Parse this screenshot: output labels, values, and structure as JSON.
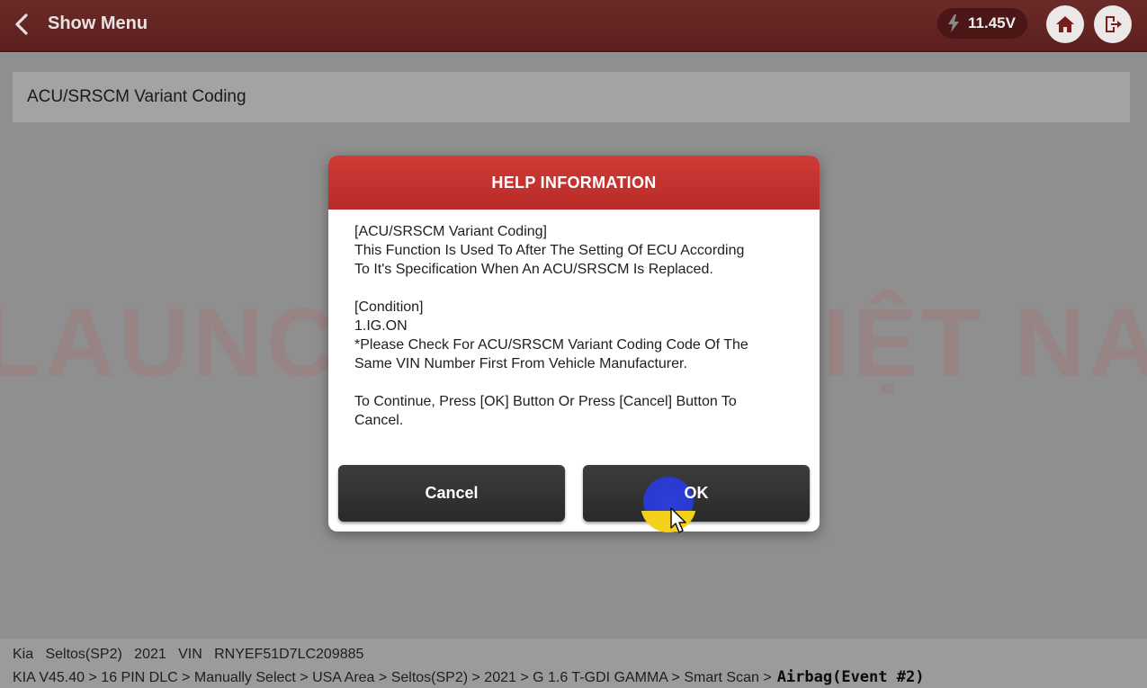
{
  "header": {
    "back_icon": "chevron-left-icon",
    "title": "Show Menu",
    "voltage": "11.45V",
    "voltage_icon": "lightning-bolt-icon",
    "home_icon": "home-icon",
    "exit_icon": "exit-icon"
  },
  "main": {
    "menu_items": [
      {
        "label": "ACU/SRSCM Variant Coding"
      }
    ],
    "watermark": "LAUNCH TECH VIỆT NAM"
  },
  "dialog": {
    "title": "HELP INFORMATION",
    "body": {
      "p1": [
        "[ACU/SRSCM Variant Coding]",
        "This Function Is Used To After The Setting Of ECU According",
        "To It's Specification When An ACU/SRSCM Is Replaced."
      ],
      "p2": [
        "[Condition]",
        "1.IG.ON",
        "*Please Check For ACU/SRSCM Variant Coding Code Of The",
        "Same VIN Number First From Vehicle Manufacturer."
      ],
      "p3": [
        "To Continue, Press [OK] Button Or Press [Cancel] Button To",
        "Cancel."
      ]
    },
    "cancel_label": "Cancel",
    "ok_label": "OK"
  },
  "footer": {
    "vehicle_info": "Kia   Seltos(SP2)   2021   VIN   RNYEF51D7LC209885",
    "path": "KIA V45.40 > 16 PIN DLC > Manually Select > USA Area > Seltos(SP2) > 2021 > G 1.6 T-GDI GAMMA > Smart Scan >",
    "current": "Airbag(Event #2)"
  },
  "colors": {
    "header_bg": "#5b1f1d",
    "dialog_header": "#c3322f",
    "button_bg": "#2f2f2f",
    "overlay_bg": "#8f8f8f",
    "click_indicator_blue": "#2739cf",
    "click_indicator_yellow": "#f3d01a"
  }
}
